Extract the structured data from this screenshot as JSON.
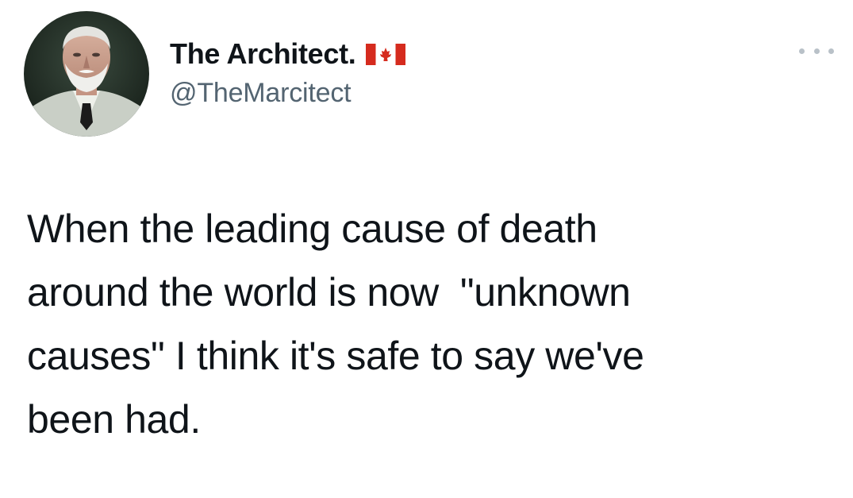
{
  "author": {
    "display_name": "The Architect.",
    "handle": "@TheMarcitect",
    "flag_icon": "canada-flag-icon",
    "avatar_icon": "profile-photo"
  },
  "more_icon": "more-horizontal-icon",
  "tweet": {
    "text": "When the leading cause of death\naround the world is now  \"unknown\ncauses\" I think it's safe to say we've\nbeen had."
  },
  "colors": {
    "text": "#0f1419",
    "secondary": "#536471",
    "flag_red": "#d52b1e"
  }
}
